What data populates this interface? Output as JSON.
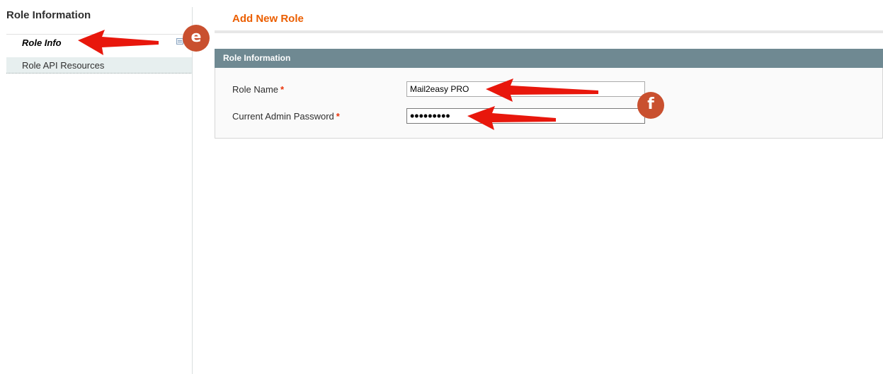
{
  "sidebar": {
    "title": "Role Information",
    "tabs": [
      {
        "label": "Role Info",
        "active": true
      },
      {
        "label": "Role API Resources",
        "active": false
      }
    ],
    "edit_icon": "edit-icon"
  },
  "main": {
    "page_title": "Add New Role",
    "fieldset": {
      "legend": "Role Information",
      "fields": [
        {
          "label": "Role Name",
          "required_mark": "*",
          "value": "Mail2easy PRO",
          "type": "text"
        },
        {
          "label": "Current Admin Password",
          "required_mark": "*",
          "value": "•••••••••",
          "type": "password"
        }
      ]
    }
  },
  "annotations": [
    {
      "label": "e",
      "color": "#c9502f"
    },
    {
      "label": "f",
      "color": "#c9502f"
    }
  ],
  "colors": {
    "accent_title": "#eb5e00",
    "fieldset_header": "#6f8992",
    "active_tab_bg": "#ffffff",
    "inactive_tab_bg": "#e7efef",
    "required": "#eb340a",
    "arrow": "#e8170c"
  }
}
